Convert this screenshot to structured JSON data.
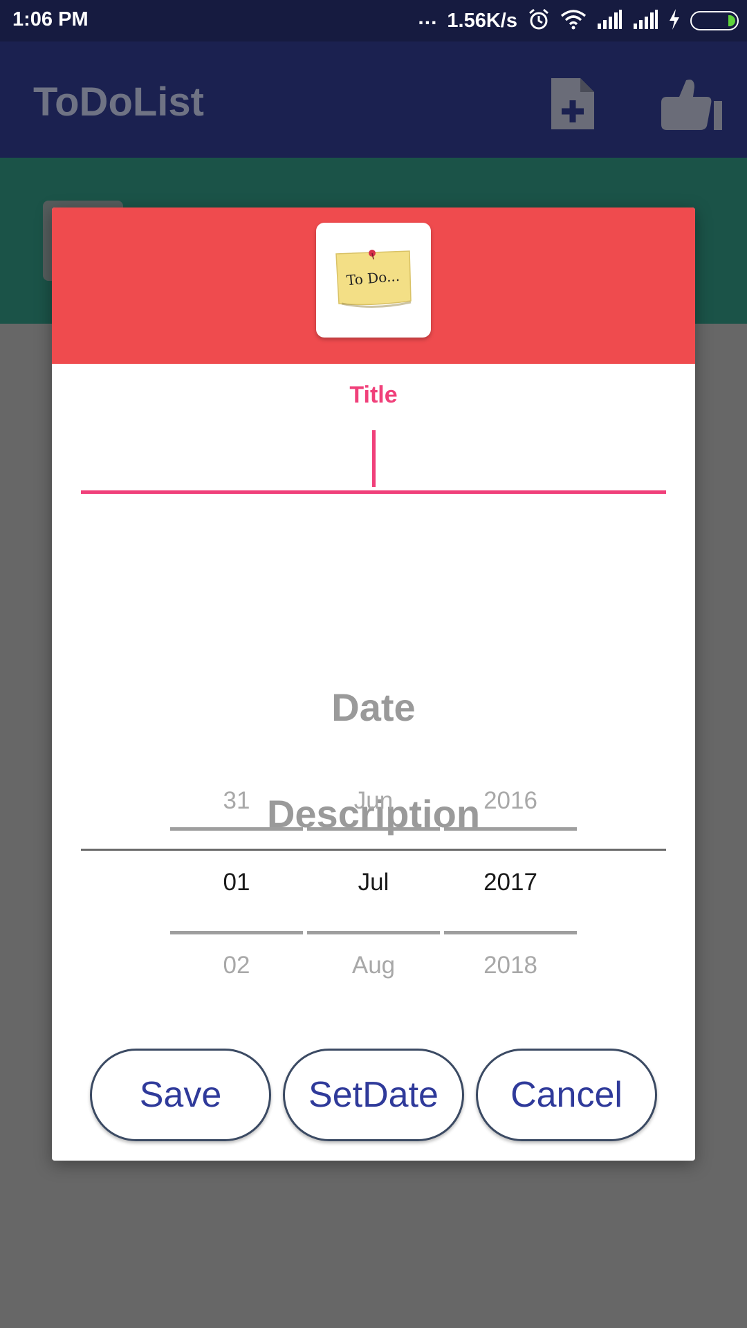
{
  "status_bar": {
    "time": "1:06 PM",
    "dots": "...",
    "net_speed": "1.56K/s",
    "icons": [
      "alarm-icon",
      "wifi-icon",
      "signal-icon",
      "signal-icon",
      "charging-icon",
      "battery-icon"
    ]
  },
  "app_bar": {
    "title": "ToDoList",
    "actions": [
      "add-note-icon",
      "thumbs-up-icon"
    ]
  },
  "dialog": {
    "logo_text": "To Do...",
    "title_label": "Title",
    "title_value": "",
    "description_placeholder": "Description",
    "date_label": "Date",
    "picker": {
      "day": {
        "prev": "31",
        "current": "01",
        "next": "02"
      },
      "month": {
        "prev": "Jun",
        "current": "Jul",
        "next": "Aug"
      },
      "year": {
        "prev": "2016",
        "current": "2017",
        "next": "2018"
      }
    },
    "buttons": {
      "save": "Save",
      "setdate": "SetDate",
      "cancel": "Cancel"
    }
  },
  "colors": {
    "status_bar": "#161b40",
    "app_bar": "#1b2150",
    "dialog_header": "#ef4b4e",
    "accent_pink": "#f0407a",
    "button_text": "#2f3a9a",
    "scrim": "#676767"
  }
}
